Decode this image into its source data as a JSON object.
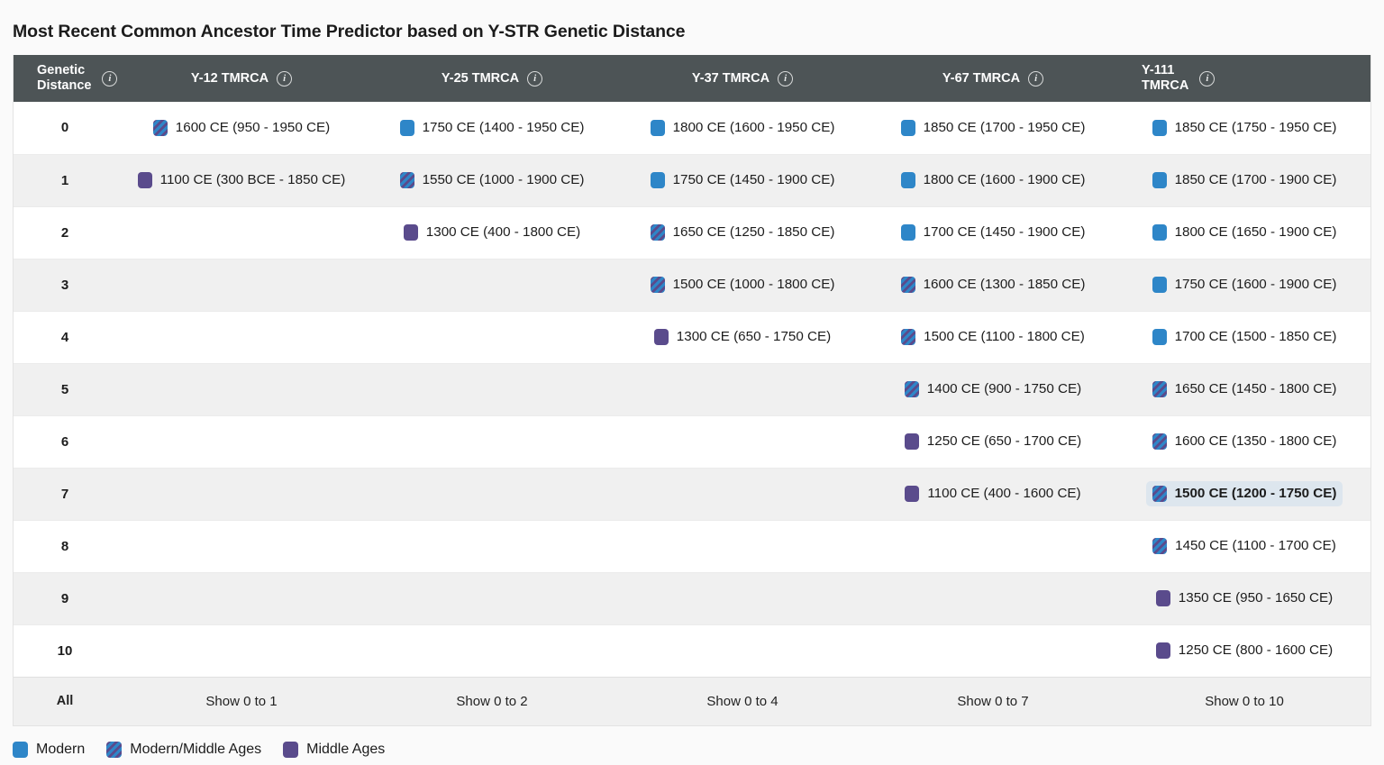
{
  "title": "Most Recent Common Ancestor Time Predictor based on Y-STR Genetic Distance",
  "table": {
    "columns": [
      {
        "label": "Genetic\nDistance",
        "info_icon": "info-icon",
        "key": "gd"
      },
      {
        "label": "Y-12 TMRCA",
        "info_icon": "info-icon",
        "key": "y12"
      },
      {
        "label": "Y-25 TMRCA",
        "info_icon": "info-icon",
        "key": "y25"
      },
      {
        "label": "Y-37 TMRCA",
        "info_icon": "info-icon",
        "key": "y37"
      },
      {
        "label": "Y-67 TMRCA",
        "info_icon": "info-icon",
        "key": "y67"
      },
      {
        "label": "Y-111\nTMRCA",
        "info_icon": "info-icon",
        "key": "y111"
      }
    ],
    "rows": [
      {
        "gd": "0",
        "cells": [
          {
            "category": "mixed",
            "text": "1600 CE (950 - 1950 CE)"
          },
          {
            "category": "modern",
            "text": "1750 CE (1400 - 1950 CE)"
          },
          {
            "category": "modern",
            "text": "1800 CE (1600 - 1950 CE)"
          },
          {
            "category": "modern",
            "text": "1850 CE (1700 - 1950 CE)"
          },
          {
            "category": "modern",
            "text": "1850 CE (1750 - 1950 CE)"
          }
        ]
      },
      {
        "gd": "1",
        "cells": [
          {
            "category": "middle",
            "text": "1100 CE (300 BCE - 1850 CE)"
          },
          {
            "category": "mixed",
            "text": "1550 CE (1000 - 1900 CE)"
          },
          {
            "category": "modern",
            "text": "1750 CE (1450 - 1900 CE)"
          },
          {
            "category": "modern",
            "text": "1800 CE (1600 - 1900 CE)"
          },
          {
            "category": "modern",
            "text": "1850 CE (1700 - 1900 CE)"
          }
        ]
      },
      {
        "gd": "2",
        "cells": [
          {
            "category": "empty",
            "text": ""
          },
          {
            "category": "middle",
            "text": "1300 CE (400 - 1800 CE)"
          },
          {
            "category": "mixed",
            "text": "1650 CE (1250 - 1850 CE)"
          },
          {
            "category": "modern",
            "text": "1700 CE (1450 - 1900 CE)"
          },
          {
            "category": "modern",
            "text": "1800 CE (1650 - 1900 CE)"
          }
        ]
      },
      {
        "gd": "3",
        "cells": [
          {
            "category": "empty",
            "text": ""
          },
          {
            "category": "empty",
            "text": ""
          },
          {
            "category": "mixed",
            "text": "1500 CE (1000 - 1800 CE)"
          },
          {
            "category": "mixed",
            "text": "1600 CE (1300 - 1850 CE)"
          },
          {
            "category": "modern",
            "text": "1750 CE (1600 - 1900 CE)"
          }
        ]
      },
      {
        "gd": "4",
        "cells": [
          {
            "category": "empty",
            "text": ""
          },
          {
            "category": "empty",
            "text": ""
          },
          {
            "category": "middle",
            "text": "1300 CE (650 - 1750 CE)"
          },
          {
            "category": "mixed",
            "text": "1500 CE (1100 - 1800 CE)"
          },
          {
            "category": "modern",
            "text": "1700 CE (1500 - 1850 CE)"
          }
        ]
      },
      {
        "gd": "5",
        "cells": [
          {
            "category": "empty",
            "text": ""
          },
          {
            "category": "empty",
            "text": ""
          },
          {
            "category": "empty",
            "text": ""
          },
          {
            "category": "mixed",
            "text": "1400 CE (900 - 1750 CE)"
          },
          {
            "category": "mixed",
            "text": "1650 CE (1450 - 1800 CE)"
          }
        ]
      },
      {
        "gd": "6",
        "cells": [
          {
            "category": "empty",
            "text": ""
          },
          {
            "category": "empty",
            "text": ""
          },
          {
            "category": "empty",
            "text": ""
          },
          {
            "category": "middle",
            "text": "1250 CE (650 - 1700 CE)"
          },
          {
            "category": "mixed",
            "text": "1600 CE (1350 - 1800 CE)"
          }
        ]
      },
      {
        "gd": "7",
        "cells": [
          {
            "category": "empty",
            "text": ""
          },
          {
            "category": "empty",
            "text": ""
          },
          {
            "category": "empty",
            "text": ""
          },
          {
            "category": "middle",
            "text": "1100 CE (400 - 1600 CE)"
          },
          {
            "category": "mixed",
            "text": "1500 CE (1200 - 1750 CE)",
            "highlighted": true
          }
        ]
      },
      {
        "gd": "8",
        "cells": [
          {
            "category": "empty",
            "text": ""
          },
          {
            "category": "empty",
            "text": ""
          },
          {
            "category": "empty",
            "text": ""
          },
          {
            "category": "empty",
            "text": ""
          },
          {
            "category": "mixed",
            "text": "1450 CE (1100 - 1700 CE)"
          }
        ]
      },
      {
        "gd": "9",
        "cells": [
          {
            "category": "empty",
            "text": ""
          },
          {
            "category": "empty",
            "text": ""
          },
          {
            "category": "empty",
            "text": ""
          },
          {
            "category": "empty",
            "text": ""
          },
          {
            "category": "middle",
            "text": "1350 CE (950 - 1650 CE)"
          }
        ]
      },
      {
        "gd": "10",
        "cells": [
          {
            "category": "empty",
            "text": ""
          },
          {
            "category": "empty",
            "text": ""
          },
          {
            "category": "empty",
            "text": ""
          },
          {
            "category": "empty",
            "text": ""
          },
          {
            "category": "middle",
            "text": "1250 CE (800 - 1600 CE)"
          }
        ]
      }
    ],
    "footer": {
      "gd_label": "All",
      "show_labels": [
        "Show 0 to 1",
        "Show 0 to 2",
        "Show 0 to 4",
        "Show 0 to 7",
        "Show 0 to 10"
      ]
    }
  },
  "legend": [
    {
      "label": "Modern",
      "category": "modern",
      "color": "#2e86c8"
    },
    {
      "label": "Modern/Middle Ages",
      "category": "mixed",
      "color": "#2e86c8"
    },
    {
      "label": "Middle Ages",
      "category": "middle",
      "color": "#5a4b8c"
    }
  ],
  "colors": {
    "header_bg": "#4d5456",
    "row_alt_bg": "#f0f0f0",
    "row_bg": "#ffffff",
    "highlight_bg": "#dde6ee",
    "modern": "#2e86c8",
    "middle_ages": "#5a4b8c",
    "page_bg": "#fafafa"
  }
}
